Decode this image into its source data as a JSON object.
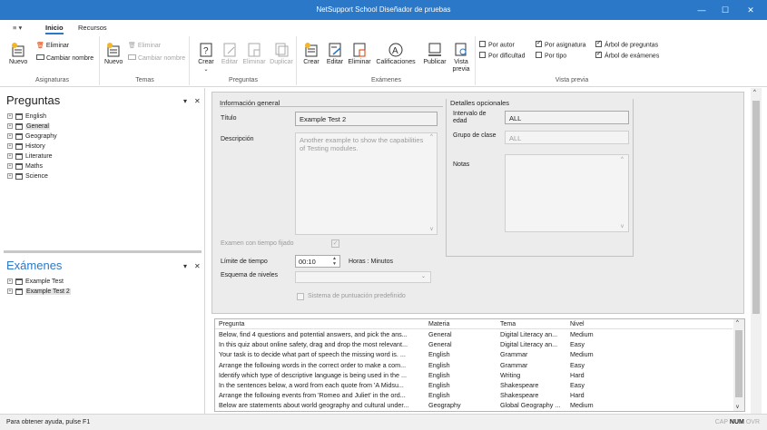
{
  "window": {
    "title": "NetSupport School Diseñador de pruebas",
    "minimize": "—",
    "maximize": "☐",
    "close": "✕"
  },
  "tabs": {
    "quick_access": "≡ ▾",
    "items": [
      "Inicio",
      "Recursos"
    ]
  },
  "ribbon": {
    "asignaturas": {
      "label": "Asignaturas",
      "nuevo": "Nuevo",
      "eliminar": "Eliminar",
      "cambiar_nombre": "Cambiar nombre"
    },
    "temas": {
      "label": "Temas",
      "nuevo": "Nuevo",
      "eliminar": "Eliminar",
      "cambiar_nombre": "Cambiar nombre"
    },
    "preguntas": {
      "label": "Preguntas",
      "crear": "Crear",
      "editar": "Editar",
      "eliminar": "Eliminar",
      "duplicar": "Duplicar"
    },
    "examenes": {
      "label": "Exámenes",
      "crear": "Crear",
      "editar": "Editar",
      "eliminar": "Eliminar",
      "calificaciones": "Calificaciones",
      "publicar": "Publicar",
      "vista_previa": "Vista previa"
    },
    "vista_previa": {
      "label": "Vista previa",
      "options": [
        {
          "text": "Por autor",
          "checked": false
        },
        {
          "text": "Por dificultad",
          "checked": false
        },
        {
          "text": "Por asignatura",
          "checked": true
        },
        {
          "text": "Por tipo",
          "checked": false
        },
        {
          "text": "Árbol de preguntas",
          "checked": true
        },
        {
          "text": "Árbol de exámenes",
          "checked": true
        }
      ]
    }
  },
  "preguntas_panel": {
    "title": "Preguntas",
    "pin": "▾",
    "close": "✕",
    "items": [
      "English",
      "General",
      "Geography",
      "History",
      "Literature",
      "Maths",
      "Science"
    ],
    "selected": "General"
  },
  "examenes_panel": {
    "title": "Exámenes",
    "pin": "▾",
    "close": "✕",
    "items": [
      "Example Test",
      "Example Test 2"
    ],
    "selected": "Example Test 2"
  },
  "form": {
    "general_title": "Información general",
    "optional_title": "Detalles opcionales",
    "titulo_label": "Título",
    "titulo_value": "Example Test 2",
    "descripcion_label": "Descripción",
    "descripcion_value": "Another example to show the capabilities of Testing modules.",
    "intervalo_label": "Intervalo de edad",
    "intervalo_value": "ALL",
    "grupo_label": "Grupo de clase",
    "grupo_value": "ALL",
    "notas_label": "Notas",
    "tiempo_fijado_label": "Examen con tiempo fijado",
    "limite_label": "Límite de tiempo",
    "limite_value": "00:10",
    "horas_label": "Horas : Minutos",
    "esquema_label": "Esquema de niveles",
    "puntuacion_label": "Sistema de puntuación predefinido"
  },
  "question_list": {
    "headers": [
      "Pregunta",
      "Materia",
      "Tema",
      "Nivel"
    ],
    "rows": [
      [
        "Below, find 4 questions and potential answers, and pick the ans...",
        "General",
        "Digital Literacy an...",
        "Medium"
      ],
      [
        "In this quiz about online safety, drag and drop the most relevant...",
        "General",
        "Digital Literacy an...",
        "Easy"
      ],
      [
        "Your task is to decide what part of speech the missing word is. ...",
        "English",
        "Grammar",
        "Medium"
      ],
      [
        "Arrange the following words in the correct order to make a com...",
        "English",
        "Grammar",
        "Easy"
      ],
      [
        "Identify which type of descriptive language is being used in the ...",
        "English",
        "Writing",
        "Hard"
      ],
      [
        "In the sentences below, a word from each quote from 'A Midsu...",
        "English",
        "Shakespeare",
        "Easy"
      ],
      [
        "Arrange the following events from 'Romeo and Juliet' in the ord...",
        "English",
        "Shakespeare",
        "Hard"
      ],
      [
        "Below are statements about world geography and cultural under...",
        "Geography",
        "Global Geography ...",
        "Medium"
      ]
    ]
  },
  "statusbar": {
    "help": "Para obtener ayuda, pulse F1",
    "cap": "CAP",
    "num": "NUM",
    "ovr": "OVR"
  },
  "colors": {
    "titlebar": "#2b78c9",
    "accent": "#2b78c9"
  }
}
